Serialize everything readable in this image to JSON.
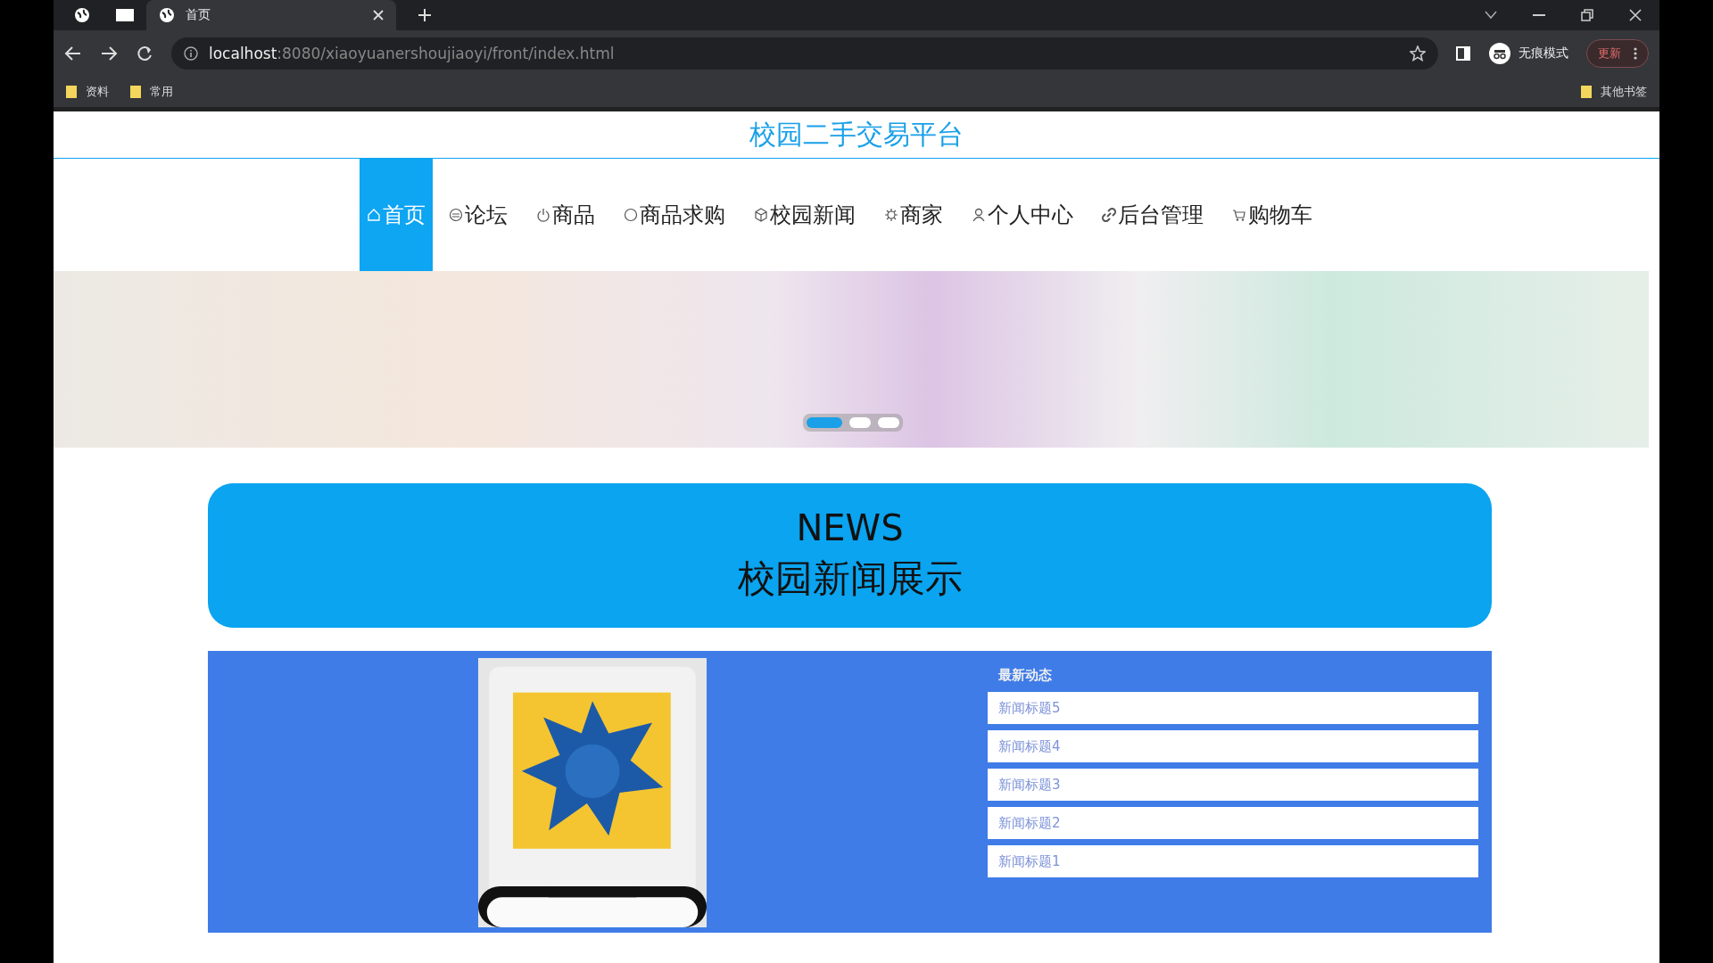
{
  "browser": {
    "tabs": [
      {
        "kind": "pinned",
        "selected": false
      },
      {
        "kind": "pinned",
        "selected": false
      },
      {
        "kind": "page",
        "title": "首页",
        "selected": true
      }
    ],
    "url": {
      "host": "localhost",
      "path": ":8080/xiaoyuanershoujiaoyi/front/index.html"
    },
    "profile": "无痕模式",
    "update_button": "更新",
    "bookmarks": [
      "资料",
      "常用"
    ],
    "other_bookmarks": "其他书签"
  },
  "site_title": "校园二手交易平台",
  "nav": [
    {
      "label": "首页",
      "selected": true
    },
    {
      "label": "论坛",
      "selected": false
    },
    {
      "label": "商品",
      "selected": false
    },
    {
      "label": "商品求购",
      "selected": false
    },
    {
      "label": "校园新闻",
      "selected": false
    },
    {
      "label": "商家",
      "selected": false
    },
    {
      "label": "个人中心",
      "selected": false
    },
    {
      "label": "后台管理",
      "selected": false
    },
    {
      "label": "购物车",
      "selected": false
    }
  ],
  "carousel": {
    "dots": [
      {
        "selected": true
      },
      {
        "selected": false
      },
      {
        "selected": false
      }
    ]
  },
  "news_header": {
    "title": "NEWS",
    "subtitle": "校园新闻展示"
  },
  "news": {
    "list_title": "最新动态",
    "items": [
      "新闻标题5",
      "新闻标题4",
      "新闻标题3",
      "新闻标题2",
      "新闻标题1"
    ]
  }
}
